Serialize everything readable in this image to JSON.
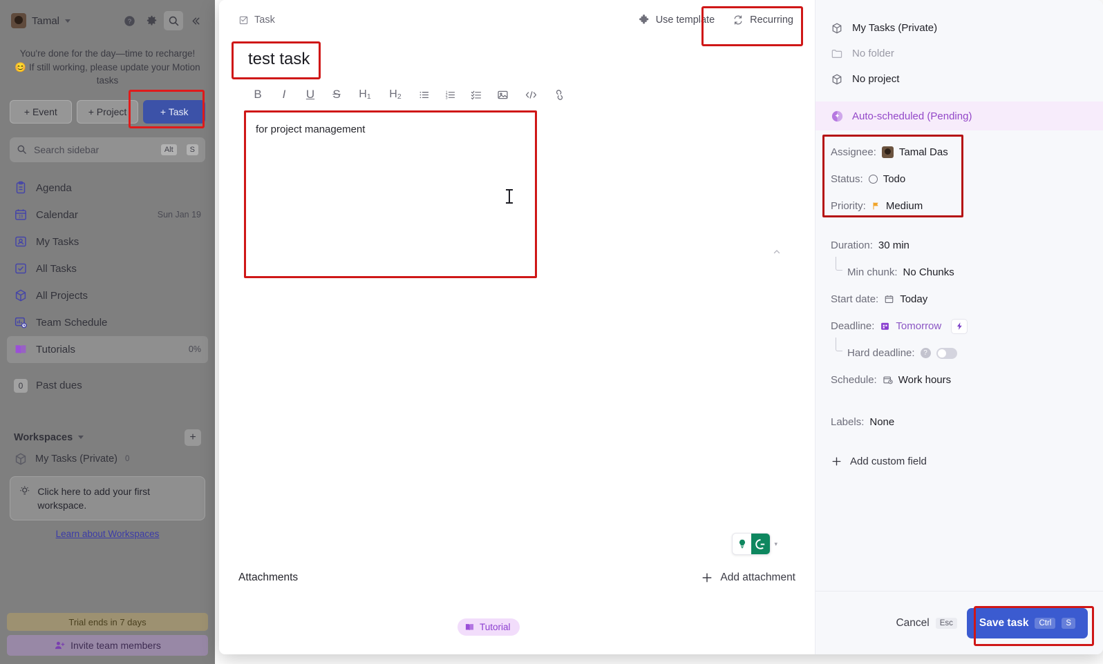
{
  "sidebar": {
    "user": {
      "name": "Tamal",
      "avatar_icon": "user-avatar"
    },
    "top_icons": [
      {
        "name": "help-icon",
        "glyph": "?"
      },
      {
        "name": "settings-gear-icon",
        "glyph": "gear"
      },
      {
        "name": "search-icon",
        "glyph": "magnifier"
      },
      {
        "name": "collapse-sidebar-icon",
        "glyph": "«"
      }
    ],
    "banner": "You're done for the day—time to recharge! 😊 If still working, please update your Motion tasks",
    "actions": [
      {
        "label": "+ Event",
        "name": "add-event-button"
      },
      {
        "label": "+ Project",
        "name": "add-project-button"
      },
      {
        "label": "+ Task",
        "name": "add-task-button"
      }
    ],
    "search": {
      "placeholder": "Search sidebar",
      "shortcut_mod": "Alt",
      "shortcut_key": "S"
    },
    "nav": [
      {
        "label": "Agenda",
        "meta": "",
        "icon": "clipboard-icon"
      },
      {
        "label": "Calendar",
        "meta": "Sun Jan 19",
        "icon": "calendar-icon"
      },
      {
        "label": "My Tasks",
        "meta": "",
        "icon": "my-tasks-icon"
      },
      {
        "label": "All Tasks",
        "meta": "",
        "icon": "all-tasks-icon"
      },
      {
        "label": "All Projects",
        "meta": "",
        "icon": "cube-icon"
      },
      {
        "label": "Team Schedule",
        "meta": "",
        "icon": "team-schedule-icon"
      },
      {
        "label": "Tutorials",
        "meta": "0%",
        "icon": "book-icon"
      }
    ],
    "past_dues": {
      "count": "0",
      "label": "Past dues"
    },
    "workspaces": {
      "title": "Workspaces",
      "add_label": "+",
      "item": {
        "label": "My Tasks (Private)",
        "count": "0"
      },
      "tip": "Click here to add your first workspace.",
      "learn_link": "Learn about Workspaces"
    },
    "footer": {
      "trial": "Trial ends in 7 days",
      "invite": "Invite team members"
    }
  },
  "modal": {
    "type_label": "Task",
    "use_template_label": "Use template",
    "recurring_label": "Recurring",
    "task_title": "test task",
    "description": "for project management",
    "format_buttons": [
      {
        "label": "B",
        "name": "bold-icon"
      },
      {
        "label": "I",
        "name": "italic-icon"
      },
      {
        "label": "U",
        "name": "underline-icon"
      },
      {
        "label": "S",
        "name": "strikethrough-icon"
      },
      {
        "label": "H1",
        "name": "heading-1-icon"
      },
      {
        "label": "H2",
        "name": "heading-2-icon"
      },
      {
        "label": "☰",
        "name": "bullet-list-icon"
      },
      {
        "label": "≡",
        "name": "numbered-list-icon"
      },
      {
        "label": "☑",
        "name": "checklist-icon"
      },
      {
        "label": "▣",
        "name": "image-icon"
      },
      {
        "label": "</>",
        "name": "code-icon"
      },
      {
        "label": "🔗",
        "name": "link-icon"
      }
    ],
    "attachments_label": "Attachments",
    "add_attachment_label": "Add attachment",
    "tutorial_chip": "Tutorial",
    "grammarly": {
      "name": "grammarly-widget",
      "letter": "G"
    }
  },
  "details": {
    "workspace": "My Tasks (Private)",
    "folder": "No folder",
    "project": "No project",
    "auto_scheduled": "Auto-scheduled (Pending)",
    "fields": [
      {
        "key": "Assignee:",
        "value": "Tamal Das"
      },
      {
        "key": "Status:",
        "value": "Todo"
      },
      {
        "key": "Priority:",
        "value": "Medium"
      }
    ],
    "duration": {
      "key": "Duration:",
      "value": "30 min"
    },
    "min_chunk": {
      "key": "Min chunk:",
      "value": "No Chunks"
    },
    "start_date": {
      "key": "Start date:",
      "value": "Today"
    },
    "deadline": {
      "key": "Deadline:",
      "value": "Tomorrow"
    },
    "hard_deadline": {
      "key": "Hard deadline:",
      "value": ""
    },
    "schedule": {
      "key": "Schedule:",
      "value": "Work hours"
    },
    "labels": {
      "key": "Labels:",
      "value": "None"
    },
    "add_custom_field": "Add custom field"
  },
  "footer": {
    "cancel_label": "Cancel",
    "cancel_shortcut": "Esc",
    "save_label": "Save task",
    "save_shortcut_mod": "Ctrl",
    "save_shortcut_key": "S"
  },
  "colors": {
    "primary_button": "#3b5bd0",
    "highlight_box": "#cf1717",
    "auto_schedule_purple": "#9347c8",
    "tutorial_chip": "#8c3fd0"
  }
}
